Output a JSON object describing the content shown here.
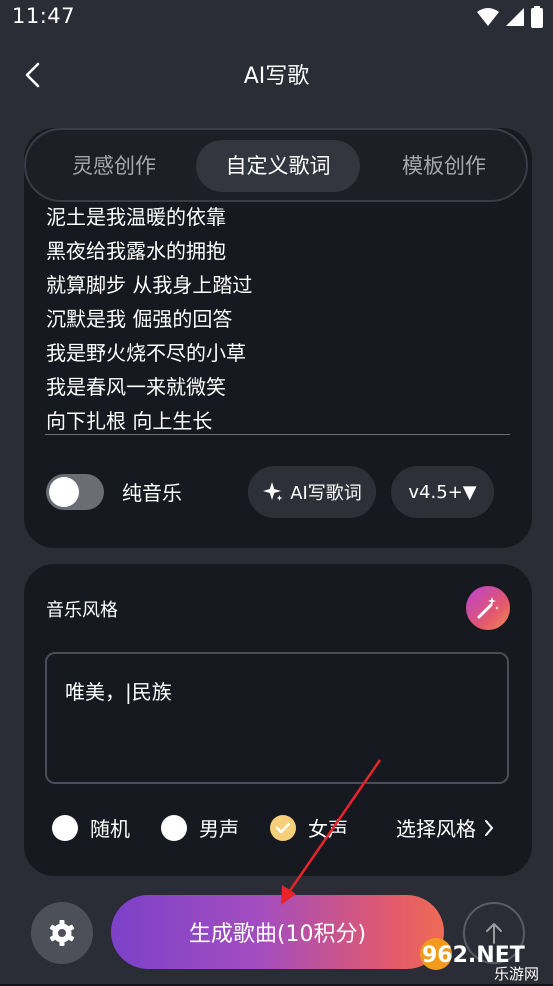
{
  "status_bar": {
    "time": "11:47"
  },
  "header": {
    "title": "AI写歌"
  },
  "tabs": [
    {
      "label": "灵感创作",
      "active": false
    },
    {
      "label": "自定义歌词",
      "active": true
    },
    {
      "label": "模板创作",
      "active": false
    }
  ],
  "lyrics": [
    "泥土是我温暖的依靠",
    "黑夜给我露水的拥抱",
    "就算脚步 从我身上踏过",
    "沉默是我 倔强的回答",
    "我是野火烧不尽的小草",
    "我是春风一来就微笑",
    "向下扎根 向上生长"
  ],
  "pure_music": {
    "label": "纯音乐",
    "on": false
  },
  "ai_lyrics_button": {
    "label": "AI写歌词"
  },
  "version_select": {
    "label": "v4.5+▼"
  },
  "music_style": {
    "title": "音乐风格",
    "input_value": "唯美，|民族",
    "voices": [
      {
        "label": "随机",
        "checked": false
      },
      {
        "label": "男声",
        "checked": false
      },
      {
        "label": "女声",
        "checked": true
      }
    ],
    "select_style_label": "选择风格"
  },
  "generate_button": {
    "label": "生成歌曲(10积分)"
  },
  "watermark": {
    "text": "962.NET",
    "subtext": "乐游网"
  },
  "colors": {
    "accent_gradient_start": "#7c41c8",
    "accent_gradient_end": "#ef6b55",
    "checked_radio": "#f7cf7a",
    "annotation_arrow": "#e8242b"
  }
}
